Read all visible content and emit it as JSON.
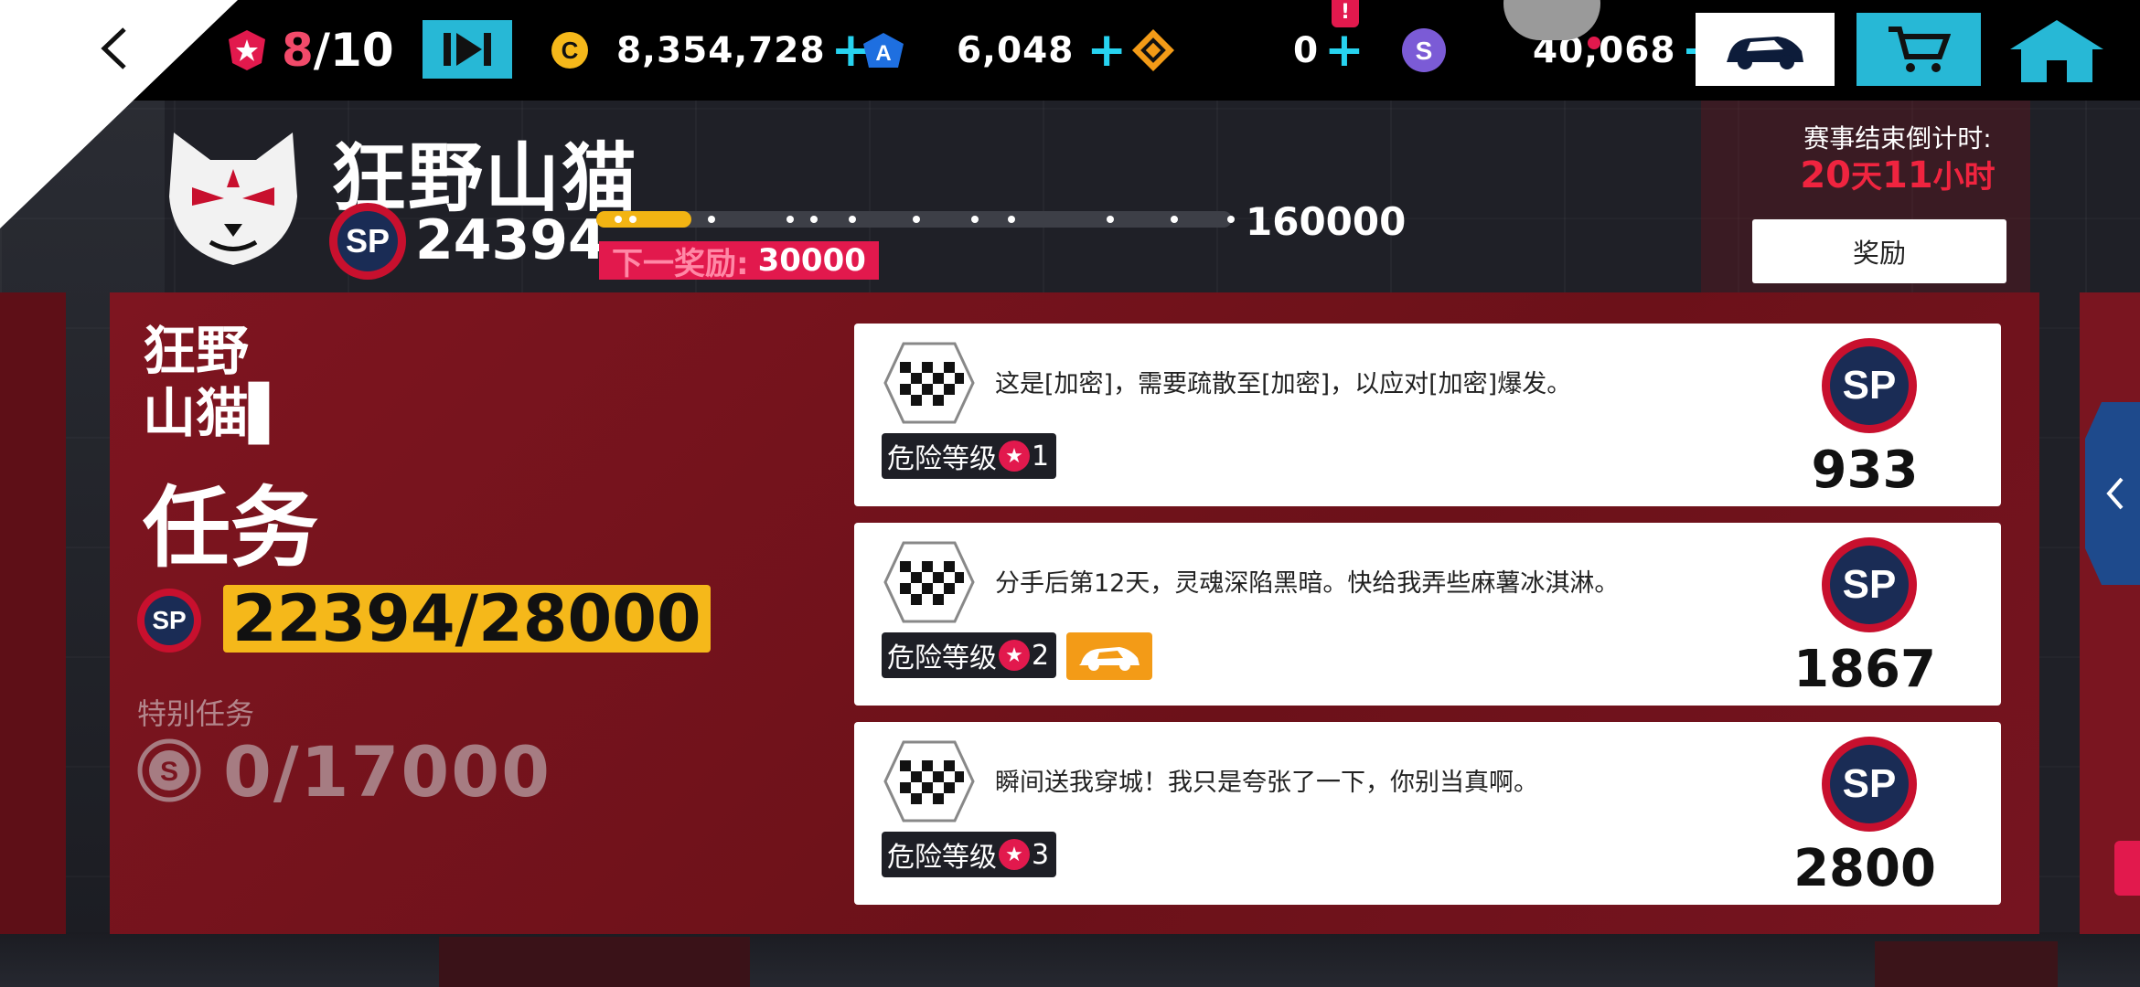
{
  "topbar": {
    "heat_current": "8",
    "heat_max": "/10",
    "credits": "8,354,728",
    "tokens": "6,048",
    "misc_count": "0",
    "sponsor_credits": "40,068",
    "alert_badge": "!"
  },
  "event": {
    "title": "狂野山猫",
    "score": "24394",
    "track_end": "160000",
    "progress": 0.15,
    "next_reward_label": "下一奖励:",
    "next_reward_value": "30000",
    "countdown_label": "赛事结束倒计时:",
    "countdown_days": "20",
    "countdown_days_unit": "天",
    "countdown_hours": "11",
    "countdown_hours_unit": "小时",
    "reward_button": "奖励"
  },
  "panel": {
    "title_line1": "狂野",
    "title_line2": "山猫▌",
    "subtitle": "任务",
    "mission_score": "22394/28000",
    "special_label": "特别任务",
    "special_score": "0/17000"
  },
  "missions": [
    {
      "text": "这是[加密]，需要疏散至[加密]，以应对[加密]爆发。",
      "danger_label": "危险等级",
      "danger_level": "1",
      "reward": "933"
    },
    {
      "text": "分手后第12天，灵魂深陷黑暗。快给我弄些麻薯冰淇淋。",
      "danger_label": "危险等级",
      "danger_level": "2",
      "reward": "1867"
    },
    {
      "text": "瞬间送我穿城！我只是夸张了一下，你别当真啊。",
      "danger_label": "危险等级",
      "danger_level": "3",
      "reward": "2800"
    }
  ],
  "sp_label": "SP",
  "colors": {
    "accent_red": "#e2194d",
    "gold": "#f5b81a",
    "cyan": "#27b8d6",
    "panel_red": "#7e1520"
  }
}
